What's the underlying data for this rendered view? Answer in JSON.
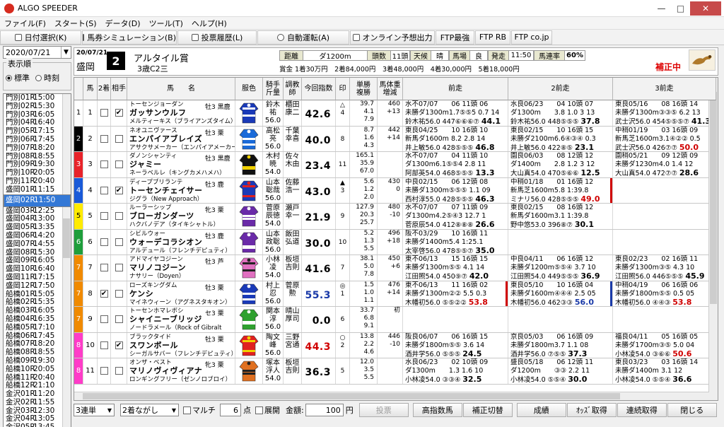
{
  "window": {
    "title": "ALGO SPEEDER"
  },
  "menu": [
    "ファイル(F)",
    "スタート(S)",
    "データ(D)",
    "ツール(T)",
    "ヘルプ(H)"
  ],
  "toolbar": {
    "date_select": "日付選択(K)",
    "ticket_sim": "馬券シミュレーション(B)",
    "vote_history": "投票履歴(L)",
    "auto_vote": "自動運転(A)",
    "online_pred": "オンライン予想出力",
    "ftp_best": "FTP最強",
    "ftp_rb": "FTP RB",
    "ftp_co": "FTP co.jp"
  },
  "left": {
    "date": "2020/07/21",
    "order_label": "表示順",
    "order_std": "標準",
    "order_time": "時刻",
    "races": [
      {
        "code": "門別01R",
        "time": "15:00"
      },
      {
        "code": "門別02R",
        "time": "15:30"
      },
      {
        "code": "門別03R",
        "time": "16:05"
      },
      {
        "code": "門別04R",
        "time": "16:40"
      },
      {
        "code": "門別05R",
        "time": "17:15"
      },
      {
        "code": "門別06R",
        "time": "17:45"
      },
      {
        "code": "門別07R",
        "time": "18:20"
      },
      {
        "code": "門別08R",
        "time": "18:55"
      },
      {
        "code": "門別09R",
        "time": "19:30"
      },
      {
        "code": "門別10R",
        "time": "20:05"
      },
      {
        "code": "門別11R",
        "time": "20:40"
      },
      {
        "code": "盛岡01R",
        "time": "11:15"
      },
      {
        "code": "盛岡02R",
        "time": "11:50"
      },
      {
        "code": "盛岡03R",
        "time": "12:25"
      },
      {
        "code": "盛岡04R",
        "time": "13:00"
      },
      {
        "code": "盛岡05R",
        "time": "13:35"
      },
      {
        "code": "盛岡06R",
        "time": "14:20"
      },
      {
        "code": "盛岡07R",
        "time": "14:55"
      },
      {
        "code": "盛岡08R",
        "time": "15:30"
      },
      {
        "code": "盛岡09R",
        "time": "16:05"
      },
      {
        "code": "盛岡10R",
        "time": "16:40"
      },
      {
        "code": "盛岡11R",
        "time": "17:15"
      },
      {
        "code": "盛岡12R",
        "time": "17:50"
      },
      {
        "code": "船橋01R",
        "time": "15:05"
      },
      {
        "code": "船橋02R",
        "time": "15:35"
      },
      {
        "code": "船橋03R",
        "time": "16:05"
      },
      {
        "code": "船橋04R",
        "time": "16:35"
      },
      {
        "code": "船橋05R",
        "time": "17:10"
      },
      {
        "code": "船橋06R",
        "time": "17:45"
      },
      {
        "code": "船橋07R",
        "time": "18:20"
      },
      {
        "code": "船橋08R",
        "time": "18:55"
      },
      {
        "code": "船橋09R",
        "time": "19:30"
      },
      {
        "code": "船橋10R",
        "time": "20:05"
      },
      {
        "code": "船橋11R",
        "time": "20:40"
      },
      {
        "code": "船橋12R",
        "time": "21:10"
      },
      {
        "code": "金沢01R",
        "time": "11:20"
      },
      {
        "code": "金沢02R",
        "time": "11:55"
      },
      {
        "code": "金沢03R",
        "time": "12:30"
      },
      {
        "code": "金沢04R",
        "time": "13:05"
      },
      {
        "code": "金沢05R",
        "time": "13:45"
      },
      {
        "code": "金沢06R",
        "time": "14:25"
      }
    ],
    "selected_index": 12
  },
  "header": {
    "date": "20/07/21",
    "venue": "盛岡",
    "race_no": "2",
    "race_name": "アルタイル賞",
    "race_class": "3歳C2三",
    "distance_label": "距離",
    "distance": "ダ1200m",
    "runners_label": "頭数",
    "runners": "11頭",
    "weather_label": "天候",
    "weather": "晴",
    "track_label": "馬場",
    "track": "良",
    "post_label": "発走",
    "post": "11:50",
    "hit_label": "馬連率",
    "hit_rate": "60%",
    "prize": "賞金 1着30万円　2着84,000円　3着48,000円　4着30,000円　5着18,000円",
    "correction": "補正中"
  },
  "columns": {
    "uma": "馬",
    "second": "2着",
    "partner": "相手",
    "name": "馬　　名",
    "silk": "服色",
    "jockey": "騎手\n斤量",
    "trainer": "調教\n師",
    "index": "今回指数",
    "mark": "印",
    "odds": "単勝\n複勝",
    "weight": "馬体重\n増減",
    "prev1": "前走",
    "prev2": "2前走",
    "prev3": "3前走"
  },
  "horses": [
    {
      "frame": "1",
      "no": "1",
      "second": false,
      "partner": true,
      "sire": "トーセンジョーダン",
      "sex": "牡3 黒鹿",
      "name": "ガッサンウルフ",
      "dam": "メルティーキス（ブライアンズタイム）",
      "jockey": "鈴木\n祐\n56.0",
      "trainer": "櫃田\n康二",
      "index": "42.6",
      "mark": "△\n4",
      "odds": "39.7\n4.1\n7.9",
      "weight": "460\n+13",
      "prev1": "水不07/07　　06 11頭 06\n未勝ダ1300m1.7⑤⑤5 0.7 14\n鈴木祐56.0 447⑥⑥⑥⑦ 44.1",
      "prev2": "水良06/23　　04 10頭 07\nダ1300m　　3.8 1.0 3 13\n鈴木祐56.0 448⑤⑤⑤ 37.8",
      "prev3": "東良05/16　　08 16頭 14\n未勝ダ1300m③③⑤ 6.2 13\n武士沢56.0 454⑤⑤⑤⑦ 41.3",
      "s1": "",
      "s2": "",
      "s3": ""
    },
    {
      "frame": "2",
      "no": "2",
      "second": false,
      "partner": false,
      "sire": "ネオユニヴァース",
      "sex": "牡3 栗",
      "name": "エンパイアブレイズ",
      "dam": "アサクサメーカー（エンパイアメーカー）",
      "jockey": "高松\n亮\n56.0",
      "trainer": "千葉\n幸喜",
      "index": "40.0",
      "mark": "\n8",
      "odds": "8.7\n1.6\n4.3",
      "weight": "442\n+14",
      "prev1": "東良04/25　　10 16頭 10\n新馬ダ1600m 8.2 2.8 14\n井上敏56.0 428⑤⑤⑤ 46.8",
      "prev2": "東良02/15　　10 16頭 15\n未勝ダ2100m6.6④③④ 0.3\n井上敏56.0 422⑧⑤ 23.1",
      "prev3": "中稍01/19　　03 16頭 09\n新馬芝1600m3.1④②② 0.5\n武士沢56.0 426⑦⑦ 50.0",
      "s1": "",
      "s2": "",
      "s3": "r"
    },
    {
      "frame": "3",
      "no": "3",
      "second": false,
      "partner": false,
      "sire": "ダノンシャンティ",
      "sex": "牡3 黒鹿",
      "name": "ジャミー",
      "dam": "ネーラベルレ（キングカメハメハ）",
      "jockey": "木村\n暁\n54.0",
      "trainer": "佐々\n木由",
      "index": "23.4",
      "mark": "\n11",
      "odds": "165.1\n35.9\n67.0",
      "weight": "\n",
      "prev1": "水不07/07　　04 11頭 10\nダ1300m6.1⑤⑤4 2.8 11\n阿部英54.0 468⑤⑤⑤ 13.3",
      "prev2": "園良06/03　　08 12頭 12\nダ1400m　　2.8 1.2 3 12\n大山真54.0 470⑤⑥⑥ 12.5",
      "prev3": "園稍05/21　　09 12頭 09\n未勝ダ1230m4.0 1.4 12\n大山真54.0 472⑦⑦ 28.6",
      "s1": "",
      "s2": "",
      "s3": ""
    },
    {
      "frame": "4",
      "no": "4",
      "second": false,
      "partner": true,
      "sire": "ディープブリランテ",
      "sex": "牡3 鹿",
      "name": "トーセンチェイサー",
      "dam": "ジグラ（New Approach）",
      "jockey": "山本\n聡哉\n56.0",
      "trainer": "佐藤\n浩一",
      "index": "43.0",
      "mark": "▲\n3",
      "odds": "5.6\n1.2\n2.0",
      "weight": "430\n0",
      "prev1": "中良02/15　　06 12頭 08\n未勝ダ1300m⑤⑤⑤ 1.1 09\n西村淳55.0 428⑤⑤⑤ 46.3",
      "prev2": "中稍01/18　　01 16頭 12\n新馬芝1600m5.8 1:39.8\nミナリ56.0 428⑤⑤⑤ 49.0",
      "prev3": "",
      "s1": "",
      "s2": "r",
      "s3": ""
    },
    {
      "frame": "5",
      "no": "5",
      "second": false,
      "partner": false,
      "sire": "ルーラーシップ",
      "sex": "牝3 栗",
      "name": "ブローガンダーツ",
      "dam": "ハクバノデア（タイキシャトル）",
      "jockey": "菅原\n辰徳\n54.0",
      "trainer": "瀬戸\n幸一",
      "index": "21.9",
      "mark": "\n9",
      "odds": "127.9\n20.3\n25.7",
      "weight": "480\n-10",
      "prev1": "水不07/07　　07 11頭 09\nダ1300m4.2⑤④3 12.7 1\n菅原辰54.0 412⑧⑧⑧ 26.6",
      "prev2": "東良02/15　　08 16頭 12\n新馬ダ1600m3.1 1:39.8\n野中悠53.0 396⑧⑦ 30.1",
      "prev3": "",
      "s1": "",
      "s2": "",
      "s3": ""
    },
    {
      "frame": "6",
      "no": "6",
      "second": false,
      "partner": false,
      "sire": "シビルウォー",
      "sex": "牡3 鹿",
      "name": "ウォーデコラシオン",
      "dam": "アルデュール（フレンチデピュティ）",
      "jockey": "山本\n政聡\n56.0",
      "trainer": "飯田\n弘道",
      "index": "30.0",
      "mark": "\n10",
      "odds": "5.2\n1.3\n5.5",
      "weight": "496\n+18",
      "prev1": "阪不03/29　　10 16頭 11\n未勝ダ1400m5.4 1:25.1\n太宰啓56.0 478⑤⑤⑦ 35.0",
      "prev2": "",
      "prev3": "",
      "s1": "",
      "s2": "",
      "s3": ""
    },
    {
      "frame": "7",
      "no": "7",
      "second": false,
      "partner": false,
      "sire": "アドマイヤコジーン",
      "sex": "牡3 芦",
      "name": "マリノコジーン",
      "dam": "ナサリー（Doyen）",
      "jockey": "小林\n凌\n54.0",
      "trainer": "板垣\n吉則",
      "index": "41.6",
      "mark": "\n7",
      "odds": "38.1\n5.0\n7.8",
      "weight": "450\n+6",
      "prev1": "東不06/13　　15 16頭 15\n未勝ダ1300m⑤⑤ 4.1 14\n江田照54.0 450⑨⑦ 42.0",
      "prev2": "中良04/11　　06 16頭 12\n未勝ダ1200m⑤⑤④ 3.7 10\n江田照54.0 449⑤⑤⑤ 36.9",
      "prev3": "東良02/23　　02 16頭 11\n未勝ダ1300m③⑤ 4.3 10\n江田照56.0 446⑤⑤⑤ 45.9",
      "s1": "",
      "s2": "",
      "s3": ""
    },
    {
      "frame": "7",
      "no": "8",
      "second": true,
      "partner": false,
      "sire": "ローズキングダム",
      "sex": "牡3 栗",
      "name": "ケンシ",
      "dam": "マイネウィーン（アグネスタキオン）",
      "jockey": "村上\n忍\n56.0",
      "trainer": "菅原\n勲",
      "index": "55.3",
      "mark": "◎\n1",
      "odds": "1.5\n1.0\n1.1",
      "weight": "476\n+14",
      "prev1": "東不06/13　　11 16頭 02\n未勝ダ1300m②② 5.5 0.3\n木幡初56.0 ⑤⑤②② 53.8",
      "prev2": "東良05/10　　10 16頭 04\n未勝ダ1600m④④④ 2.5 05\n木幡初56.0 462③③ 56.0",
      "prev3": "中稍04/19　　06 16頭 06\n未勝ダ1800m⑤⑤ 0.5 05\n木幡初56.0 ④④③ 53.8",
      "s1": "r",
      "s2": "b",
      "s3": "r"
    },
    {
      "frame": "7",
      "no": "9",
      "second": false,
      "partner": false,
      "sire": "トーセンホマレボシ",
      "sex": "セ3 栗",
      "name": "シャイニーブリッジ",
      "dam": "ノードラメール（Rock of Gibralt",
      "jockey": "関本\n淳\n56.0",
      "trainer": "晴山\n厚司",
      "index": "0.0",
      "mark": "\n6",
      "odds": "33.7\n6.8\n9.1",
      "weight": "初\n",
      "prev1": "",
      "prev2": "",
      "prev3": "",
      "s1": "",
      "s2": "",
      "s3": ""
    },
    {
      "frame": "8",
      "no": "10",
      "second": false,
      "partner": true,
      "sire": "ブラックタイド",
      "sex": "牡3 栗",
      "name": "スワンボール",
      "dam": "シーガルサバー（フレンチデピュティ）",
      "jockey": "陶文\n峰\n56.0",
      "trainer": "三野\n宮通",
      "index": "44.3",
      "mark": "○\n2",
      "odds": "13.8\n2.2\n4.6",
      "weight": "446\n-10",
      "prev1": "阪良06/07　　06 16頭 15\n未勝ダ1800m⑤⑤ 3.6 14\n酒井学56.0 ⑤⑤⑤ 24.5",
      "prev2": "京良05/03　　06 16頭 09\n未勝ダ1800m3.7 1.1 08\n酒井学56.0 ⑦⑤⑤ 37.3",
      "prev3": "福良04/11　　05 16頭 05\n未勝ダ1700m③⑤ 5.0 04\n小林凌54.0 ③⑥⑥ 50.6",
      "s1": "",
      "s2": "",
      "s3": "r"
    },
    {
      "frame": "8",
      "no": "11",
      "second": false,
      "partner": false,
      "sire": "オンザ・ベスト",
      "sex": "牝3 栗",
      "name": "マリノヴィヴィアナ",
      "dam": "ロンギングフリー（ゼンノロブロイ）",
      "jockey": "塚本\n浮人\n54.0",
      "trainer": "板垣\n吉則",
      "index": "36.3",
      "mark": "\n5",
      "odds": "12.0\n3.5\n5.5",
      "weight": "\n",
      "prev1": "水良06/23　　02 10頭 09\nダ1300m　　1.3 1.6 10\n小林凌54.0 ③③④ 32.5",
      "prev2": "盛良05/18　　06 12頭 11\nダ1200m　　③③ 2.2 11\n小林凌54.0 ⑤⑤④ 30.0",
      "prev3": "東良03/23　　03 16頭 14\n未勝ダ1400m 3.1 12\n小林凌54.0 ⑤⑤④ 36.6",
      "s1": "",
      "s2": "",
      "s3": ""
    }
  ],
  "bottom": {
    "bet_type": "3連単",
    "bet_mode": "2着ながし",
    "multi_label": "マルチ",
    "points": "6",
    "points_unit": "点",
    "expand_label": "展開",
    "amount_label": "金額:",
    "amount": "100",
    "amount_unit": "円",
    "vote": "投票",
    "high_index": "高指数馬",
    "corr_switch": "補正切替",
    "result": "成績",
    "odds_get": "ｵｯｽﾞ取得",
    "cont_get": "連続取得",
    "close": "閉じる"
  },
  "colors": {
    "frames": [
      "#ffffff",
      "#000000",
      "#e8232a",
      "#1a5ad8",
      "#ffeb00",
      "#1e9e3b",
      "#f08a00",
      "#ff3cc8"
    ],
    "selected": "#3378d6",
    "accent_red": "#d00000",
    "accent_blue": "#1a3aa8"
  }
}
